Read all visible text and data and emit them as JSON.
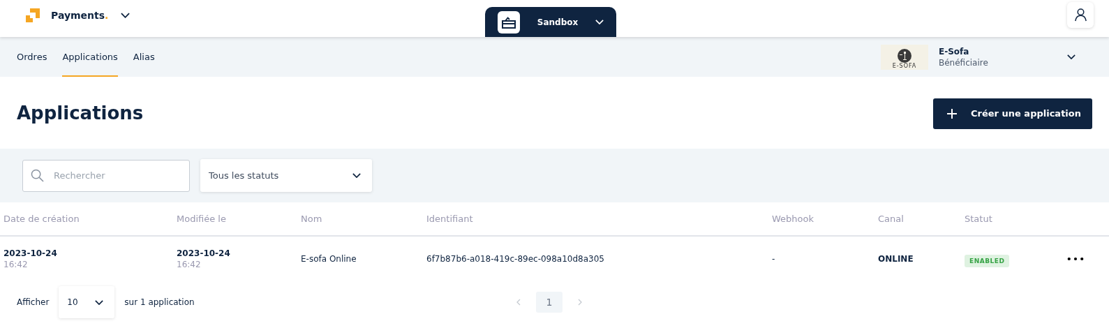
{
  "header": {
    "brand": "Payments",
    "brand_dot": ".",
    "environment": "Sandbox"
  },
  "nav": {
    "tabs": [
      {
        "label": "Ordres",
        "selected": false
      },
      {
        "label": "Applications",
        "selected": true
      },
      {
        "label": "Alias",
        "selected": false
      }
    ],
    "account": {
      "logo_text": "E-SOFA",
      "name": "E-Sofa",
      "role": "Bénéficiaire"
    }
  },
  "page": {
    "title": "Applications",
    "create_button": "Créer une application"
  },
  "filters": {
    "search": {
      "placeholder": "Rechercher"
    },
    "status_select": "Tous les statuts"
  },
  "table": {
    "columns": [
      "Date de création",
      "Modifiée le",
      "Nom",
      "Identifiant",
      "Webhook",
      "Canal",
      "Statut"
    ],
    "rows": [
      {
        "created_date": "2023-10-24",
        "created_time": "16:42",
        "modified_date": "2023-10-24",
        "modified_time": "16:42",
        "name": "E-sofa Online",
        "id": "6f7b87b6-a018-419c-89ec-098a10d8a305",
        "webhook": "-",
        "channel": "ONLINE",
        "status": {
          "label": "ENABLED",
          "kind": "enabled"
        }
      }
    ]
  },
  "pagination": {
    "show_label": "Afficher",
    "page_size": "10",
    "total": "sur 1 application",
    "pages": [
      {
        "label": "1",
        "selected": true
      }
    ]
  }
}
